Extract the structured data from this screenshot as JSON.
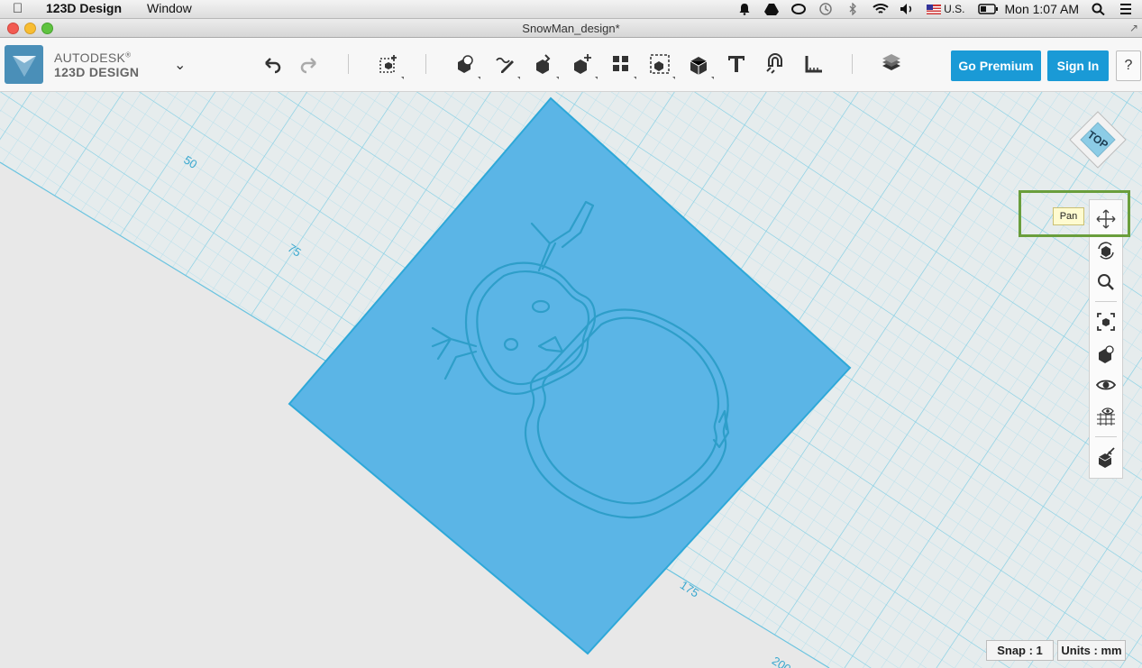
{
  "menubar": {
    "app_name": "123D Design",
    "menus": [
      "Window"
    ],
    "input_source": "U.S.",
    "clock": "Mon 1:07 AM"
  },
  "window": {
    "title": "SnowMan_design*"
  },
  "brand": {
    "line1": "AUTODESK",
    "line2": "123D DESIGN",
    "registered_mark": "®"
  },
  "toolbar": {
    "tools": [
      {
        "name": "undo-icon"
      },
      {
        "name": "redo-icon"
      },
      {
        "name": "transform-icon"
      },
      {
        "name": "primitives-icon"
      },
      {
        "name": "sketch-icon"
      },
      {
        "name": "construct-icon"
      },
      {
        "name": "modify-icon"
      },
      {
        "name": "pattern-icon"
      },
      {
        "name": "grouping-icon"
      },
      {
        "name": "combine-icon"
      },
      {
        "name": "text-icon"
      },
      {
        "name": "snap-icon"
      },
      {
        "name": "measure-icon"
      },
      {
        "name": "materials-icon"
      }
    ],
    "premium_label": "Go Premium",
    "signin_label": "Sign In",
    "help_label": "?"
  },
  "viewcube": {
    "label": "TOP"
  },
  "grid": {
    "labels": [
      "50",
      "75",
      "175",
      "200"
    ]
  },
  "navbar": {
    "tooltip": "Pan",
    "buttons": [
      "pan-icon",
      "orbit-icon",
      "zoom-icon",
      "fit-icon",
      "views-icon",
      "visibility-icon",
      "grid-visibility-icon",
      "material-icon"
    ]
  },
  "status": {
    "snap_label": "Snap : 1",
    "units_label": "Units : mm"
  },
  "colors": {
    "accent": "#1a9ad6",
    "plate": "#59b3e3",
    "grid_line": "#8fd0e3",
    "highlight_box": "#6a9e3c"
  }
}
